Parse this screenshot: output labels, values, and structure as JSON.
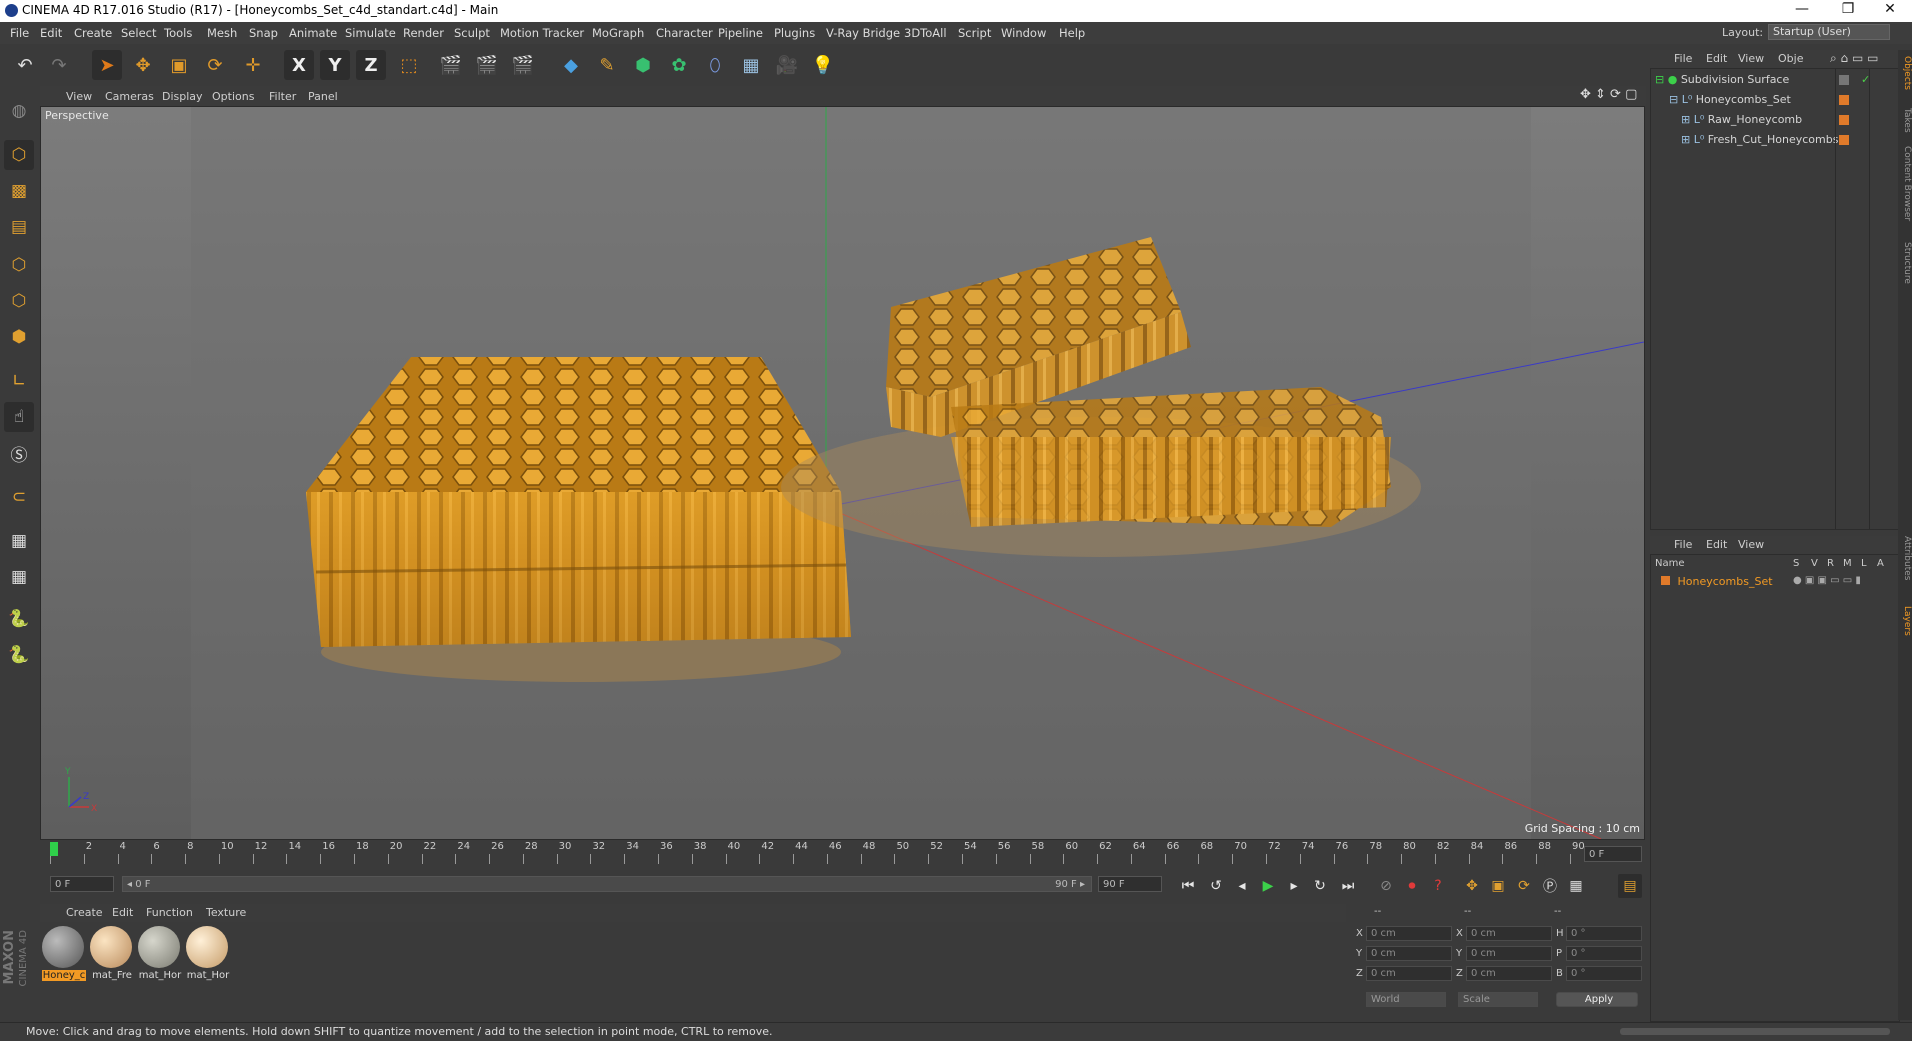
{
  "window": {
    "title": "CINEMA 4D R17.016 Studio (R17) - [Honeycombs_Set_c4d_standart.c4d] - Main",
    "minimize": "—",
    "restore": "❐",
    "close": "✕"
  },
  "menu": [
    "File",
    "Edit",
    "Create",
    "Select",
    "Tools",
    "Mesh",
    "Snap",
    "Animate",
    "Simulate",
    "Render",
    "Sculpt",
    "Motion Tracker",
    "MoGraph",
    "Character",
    "Pipeline",
    "Plugins",
    "V-Ray Bridge",
    "3DToAll",
    "Script",
    "Window",
    "Help"
  ],
  "layout": {
    "label": "Layout:",
    "value": "Startup (User)"
  },
  "toolbar": {
    "x_label": "X",
    "y_label": "Y",
    "z_label": "Z"
  },
  "viewport": {
    "menu": [
      "View",
      "Cameras",
      "Display",
      "Options",
      "Filter",
      "Panel"
    ],
    "label": "Perspective",
    "grid_spacing": "Grid Spacing : 10 cm",
    "axis_y": "Y",
    "axis_z": "Z",
    "axis_x": "X"
  },
  "timeline": {
    "ticks": [
      "0",
      "2",
      "4",
      "6",
      "8",
      "10",
      "12",
      "14",
      "16",
      "18",
      "20",
      "22",
      "24",
      "26",
      "28",
      "30",
      "32",
      "34",
      "36",
      "38",
      "40",
      "42",
      "44",
      "46",
      "48",
      "50",
      "52",
      "54",
      "56",
      "58",
      "60",
      "62",
      "64",
      "66",
      "68",
      "70",
      "72",
      "74",
      "76",
      "78",
      "80",
      "82",
      "84",
      "86",
      "88",
      "90"
    ],
    "current_frame": "0 F",
    "start_field": "0 F",
    "slider_start": "◂ 0 F",
    "slider_end": "90 F ▸",
    "end_field": "90 F"
  },
  "materials": {
    "menu": [
      "Create",
      "Edit",
      "Function",
      "Texture"
    ],
    "items": [
      {
        "label": "Honey_c",
        "color": "#8a8a8a",
        "selected": true
      },
      {
        "label": "mat_Fre",
        "color": "#e9c9a0",
        "selected": false
      },
      {
        "label": "mat_Hor",
        "color": "#a8a8a0",
        "selected": false
      },
      {
        "label": "mat_Hor",
        "color": "#f0d2a8",
        "selected": false
      }
    ]
  },
  "coordinates": {
    "headers": [
      "--",
      "--",
      "--"
    ],
    "rows": [
      {
        "a": "X",
        "av": "0 cm",
        "b": "X",
        "bv": "0 cm",
        "c": "H",
        "cv": "0 °"
      },
      {
        "a": "Y",
        "av": "0 cm",
        "b": "Y",
        "bv": "0 cm",
        "c": "P",
        "cv": "0 °"
      },
      {
        "a": "Z",
        "av": "0 cm",
        "b": "Z",
        "bv": "0 cm",
        "c": "B",
        "cv": "0 °"
      }
    ],
    "world": "World",
    "scale": "Scale",
    "apply": "Apply"
  },
  "objects": {
    "menu": [
      "File",
      "Edit",
      "View",
      "Obje"
    ],
    "tree": [
      {
        "name": "Subdivision Surface",
        "indent": 0
      },
      {
        "name": "Honeycombs_Set",
        "indent": 1
      },
      {
        "name": "Raw_Honeycomb",
        "indent": 2
      },
      {
        "name": "Fresh_Cut_Honeycombs",
        "indent": 2
      }
    ]
  },
  "layers": {
    "menu": [
      "File",
      "Edit",
      "View"
    ],
    "columns": [
      "Name",
      "S",
      "V",
      "R",
      "M",
      "L",
      "A"
    ],
    "row": "Honeycombs_Set"
  },
  "side_tabs": [
    "Objects",
    "Takes",
    "Content Browser",
    "Structure",
    "Attributes",
    "Layers"
  ],
  "status": "Move: Click and drag to move elements. Hold down SHIFT to quantize movement / add to the selection in point mode, CTRL to remove.",
  "brand": {
    "line1": "MAXON",
    "line2": "CINEMA 4D"
  },
  "colors": {
    "accent": "#e08a1e",
    "honey": "#d9951f",
    "selection": "#f29a24"
  }
}
